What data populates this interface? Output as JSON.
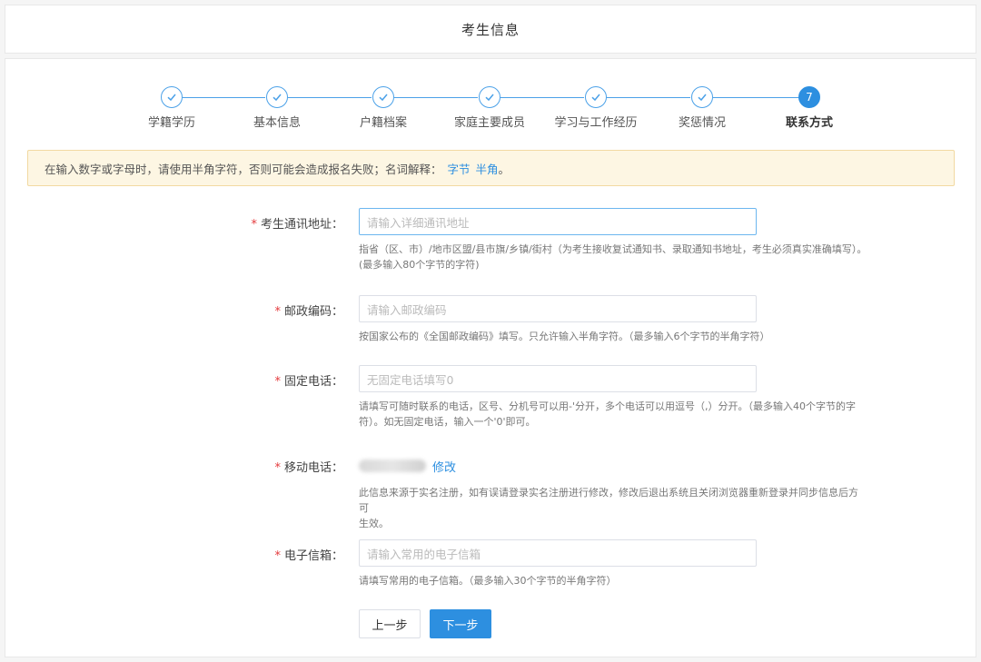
{
  "header": {
    "title": "考生信息"
  },
  "steps": [
    {
      "label": "学籍学历",
      "done": true
    },
    {
      "label": "基本信息",
      "done": true
    },
    {
      "label": "户籍档案",
      "done": true
    },
    {
      "label": "家庭主要成员",
      "done": true
    },
    {
      "label": "学习与工作经历",
      "done": true
    },
    {
      "label": "奖惩情况",
      "done": true
    },
    {
      "label": "联系方式",
      "done": false,
      "number": "7"
    }
  ],
  "notice": {
    "text": "在输入数字或字母时，请使用半角字符，否则可能会造成报名失败；名词解释：",
    "link1": "字节",
    "link2": "半角",
    "end": "。"
  },
  "form": {
    "address": {
      "label": "考生通讯地址：",
      "placeholder": "请输入详细通讯地址",
      "hint1": "指省（区、市）/地市区盟/县市旗/乡镇/街村（为考生接收复试通知书、录取通知书地址，考生必须真实准确填写）。",
      "hint2": "(最多输入80个字节的字符)"
    },
    "postcode": {
      "label": "邮政编码：",
      "placeholder": "请输入邮政编码",
      "hint1": "按国家公布的《全国邮政编码》填写。只允许输入半角字符。（最多输入6个字节的半角字符）"
    },
    "phone": {
      "label": "固定电话：",
      "placeholder": "无固定电话填写0",
      "hint1": "请填写可随时联系的电话，区号、分机号可以用-'分开，多个电话可以用逗号（,）分开。（最多输入40个字节的字",
      "hint2": "符）。如无固定电话，输入一个'0'即可。"
    },
    "mobile": {
      "label": "移动电话：",
      "modify": "修改",
      "hint1": "此信息来源于实名注册，如有误请登录实名注册进行修改，修改后退出系统且关闭浏览器重新登录并同步信息后方可",
      "hint2": "生效。"
    },
    "email": {
      "label": "电子信箱：",
      "placeholder": "请输入常用的电子信箱",
      "hint1": "请填写常用的电子信箱。（最多输入30个字节的半角字符）"
    },
    "required_mark": "*"
  },
  "buttons": {
    "prev": "上一步",
    "next": "下一步"
  },
  "colors": {
    "primary": "#2d8fe0",
    "required": "#e4393c",
    "notice_bg": "#fdf6e3"
  }
}
